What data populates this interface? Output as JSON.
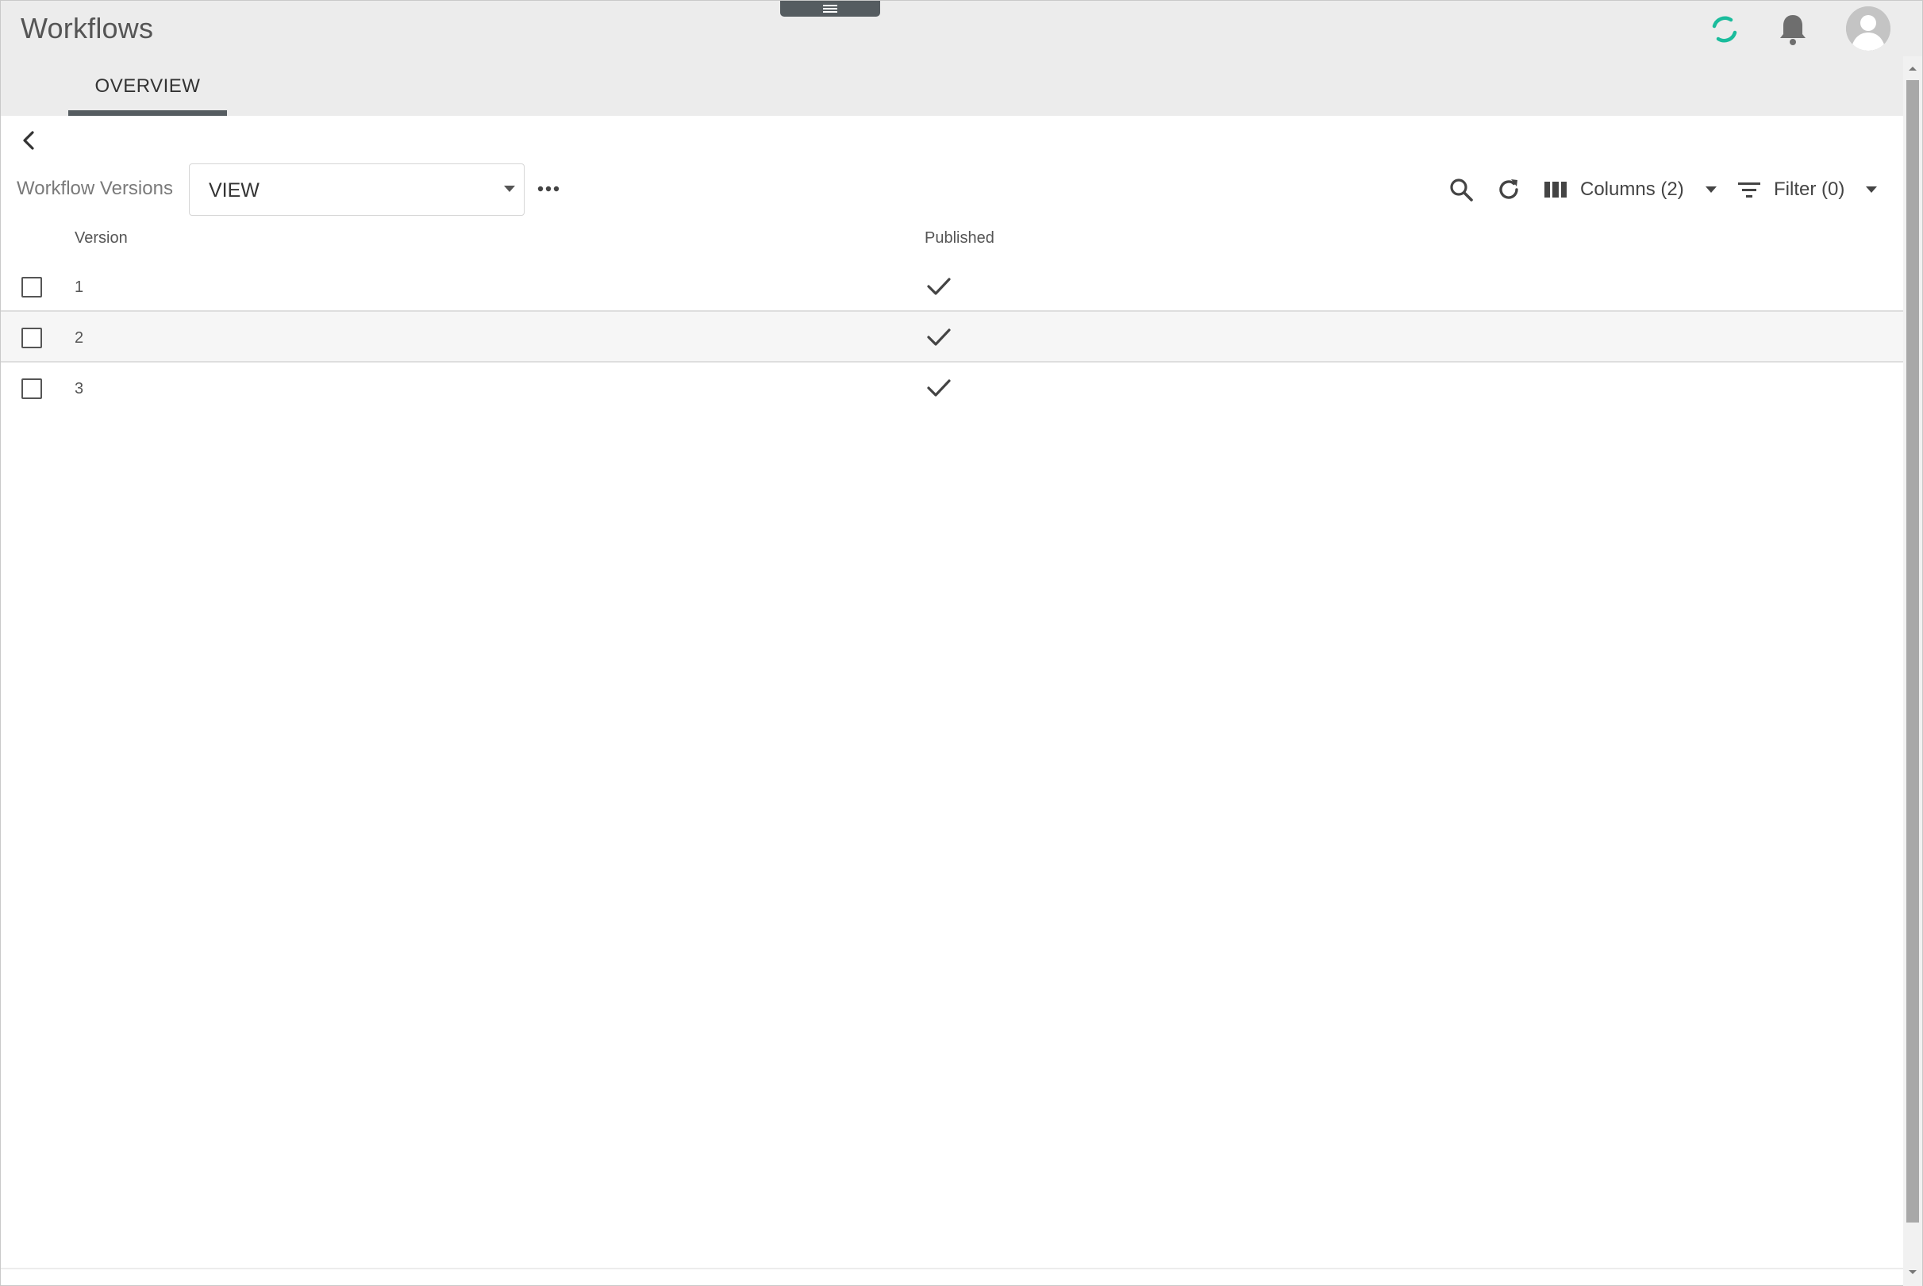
{
  "app": {
    "title": "Workflows"
  },
  "tabs": [
    {
      "label": "OVERVIEW",
      "active": true
    }
  ],
  "toolbar": {
    "label": "Workflow Versions",
    "view_select": {
      "value": "VIEW"
    },
    "columns_label": "Columns (2)",
    "filter_label": "Filter (0)"
  },
  "table": {
    "headers": [
      "Version",
      "Published"
    ],
    "rows": [
      {
        "version": "1",
        "published": true
      },
      {
        "version": "2",
        "published": true
      },
      {
        "version": "3",
        "published": true
      }
    ]
  },
  "colors": {
    "accent": "#1abc9c",
    "header_bg": "#ececec",
    "tab_underline": "#555c60"
  },
  "icons": [
    "menu-handle-icon",
    "spinner-icon",
    "bell-icon",
    "avatar-icon",
    "back-icon",
    "more-icon",
    "search-icon",
    "refresh-icon",
    "columns-icon",
    "filter-icon",
    "check-icon"
  ]
}
